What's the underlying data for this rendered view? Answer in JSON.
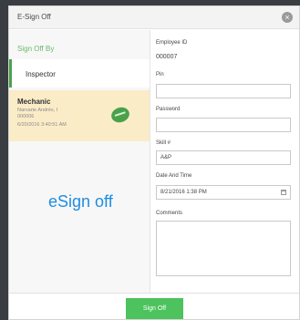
{
  "dialog": {
    "title": "E-Sign Off",
    "close_label": "×"
  },
  "sidebar": {
    "heading": "Sign Off By",
    "items": [
      {
        "label": "Inspector"
      },
      {
        "label": "Mechanic",
        "name_line": "Narvarte Andrés, I",
        "id_line": "000006",
        "date_line": "6/20/2016 3:40:51 AM"
      }
    ]
  },
  "form": {
    "employee_id_label": "Employee ID",
    "employee_id_value": "000007",
    "pin_label": "Pin",
    "pin_value": "",
    "password_label": "Password",
    "password_value": "",
    "skill_label": "Skill #",
    "skill_value": "A&P",
    "datetime_label": "Date And Time",
    "datetime_value": "8/21/2016   1:38 PM",
    "comments_label": "Comments",
    "comments_value": ""
  },
  "overlay_label": "eSign off",
  "footer": {
    "signoff_label": "Sign Off"
  },
  "colors": {
    "accent_green": "#4cc35c",
    "highlight": "#fbecc8",
    "overlay_blue": "#1f8ce2"
  },
  "icons": [
    "close-icon",
    "signature-stamp-icon",
    "calendar-icon"
  ]
}
